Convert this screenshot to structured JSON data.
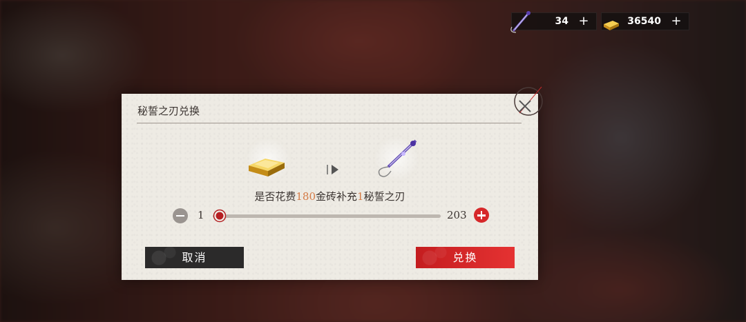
{
  "currencies": {
    "blade": {
      "icon": "sword-icon",
      "value": "34",
      "add": "+"
    },
    "gold": {
      "icon": "gold-bar-icon",
      "value": "36540",
      "add": "+"
    }
  },
  "dialog": {
    "title": "秘誓之刃兑换",
    "from_item": "gold-bar-icon",
    "to_item": "sword-icon",
    "question": {
      "prefix": "是否花费",
      "cost": "180",
      "middle": "金砖补充",
      "amount": "1",
      "suffix": "秘誓之刃"
    },
    "quantity": {
      "min": "1",
      "max": "203",
      "current_fraction": 0.0
    },
    "cancel_label": "取消",
    "confirm_label": "兑换"
  },
  "colors": {
    "accent_red": "#d6282a",
    "highlight_orange": "#d47a45"
  }
}
